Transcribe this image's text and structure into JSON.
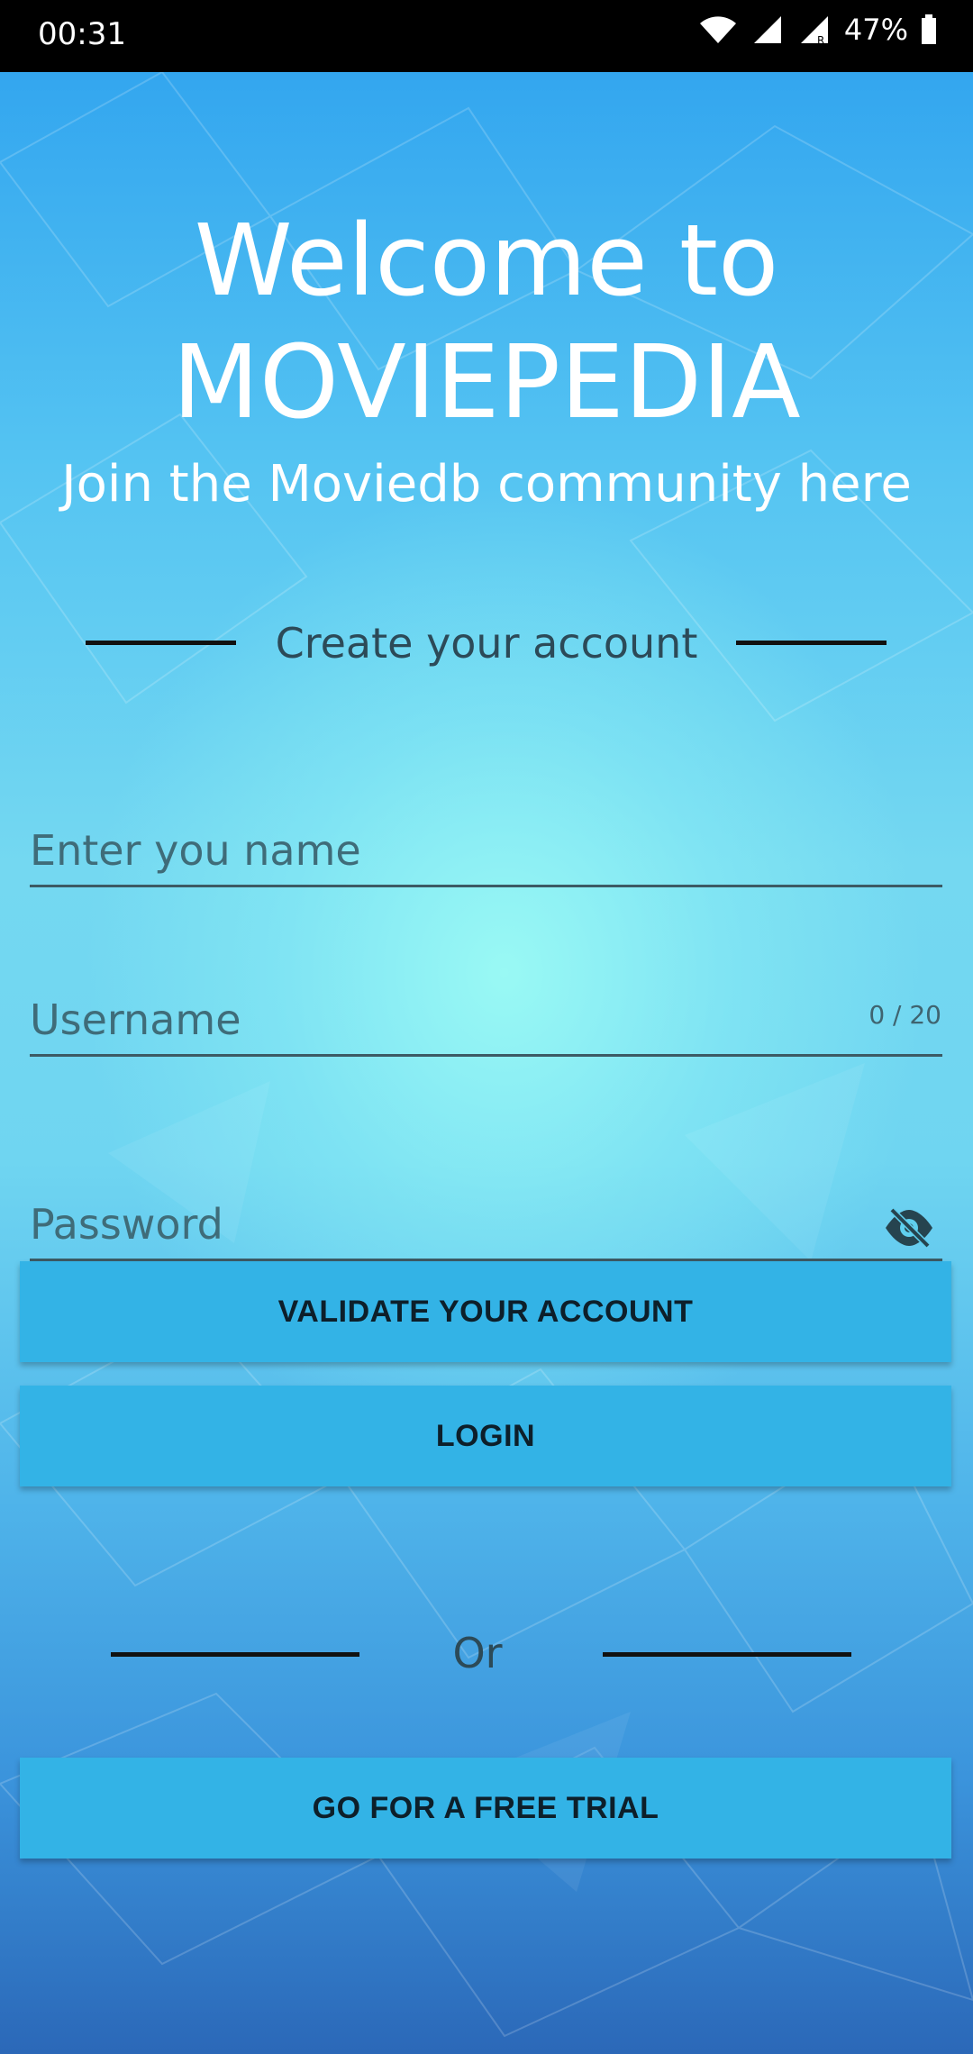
{
  "status_bar": {
    "time": "00:31",
    "battery": "47%"
  },
  "header": {
    "title_line1": "Welcome to",
    "title_line2": "MOVIEPEDIA",
    "subtitle": "Join the Moviedb community here"
  },
  "form": {
    "section_label": "Create your account",
    "name_placeholder": "Enter you name",
    "username_placeholder": "Username",
    "username_counter": "0 / 20",
    "password_placeholder": "Password"
  },
  "buttons": {
    "validate": "VALIDATE YOUR ACCOUNT",
    "login": "LOGIN",
    "or_label": "Or",
    "free_trial": "GO FOR A FREE TRIAL"
  },
  "colors": {
    "button_bg": "#33b3e6",
    "status_bar_bg": "#000000"
  },
  "icons": [
    "wifi-icon",
    "signal-icon",
    "signal-roaming-icon",
    "battery-icon",
    "visibility-off-icon"
  ]
}
